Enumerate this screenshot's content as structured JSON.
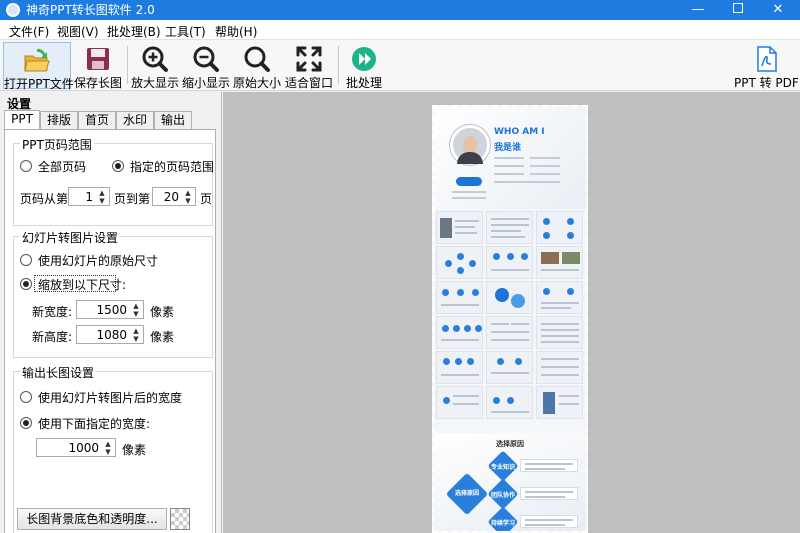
{
  "window": {
    "title": "神奇PPT转长图软件 2.0",
    "minimize_symbol": "—",
    "close_symbol": "✕"
  },
  "menu": [
    "文件(F)",
    "视图(V)",
    "批处理(B)",
    "工具(T)",
    "帮助(H)"
  ],
  "toolbar": {
    "open": "打开PPT文件",
    "save": "保存长图",
    "zoom_in": "放大显示",
    "zoom_out": "缩小显示",
    "original": "原始大小",
    "fit": "适合窗口",
    "batch": "批处理",
    "pdf": "PPT 转 PDF"
  },
  "panel": {
    "title": "设置",
    "tabs": [
      "PPT",
      "排版",
      "首页",
      "水印",
      "输出"
    ],
    "ppt_range": {
      "title": "PPT页码范围",
      "all_pages": "全部页码",
      "specified": "指定的页码范围",
      "selected": "specified",
      "from_label": "页码从第",
      "from_value": "1",
      "to_label": "页到第",
      "to_value": "20",
      "suffix": "页"
    },
    "slide_image": {
      "title": "幻灯片转图片设置",
      "original_size": "使用幻灯片的原始尺寸",
      "scale_to": "缩放到以下尺寸:",
      "selected": "scale_to",
      "width_label": "新宽度:",
      "width_value": "1500",
      "height_label": "新高度:",
      "height_value": "1080",
      "unit": "像素"
    },
    "output_image": {
      "title": "输出长图设置",
      "use_converted_width": "使用幻灯片转图片后的宽度",
      "use_specified_width": "使用下面指定的宽度:",
      "selected": "use_specified_width",
      "width_value": "1000",
      "unit": "像素"
    },
    "background_button": "长图背景底色和透明度..."
  },
  "preview": {
    "hero_title": "WHO AM I",
    "hero_subtitle": "我是谁",
    "section_title": "选择原因",
    "center_label": "选择原因",
    "node_labels": [
      "专业知识",
      "团队协作",
      "持续学习"
    ]
  },
  "colors": {
    "titlebar": "#1e7be0",
    "accent": "#1c74d6",
    "preview_bg": "#bfbfbf"
  }
}
